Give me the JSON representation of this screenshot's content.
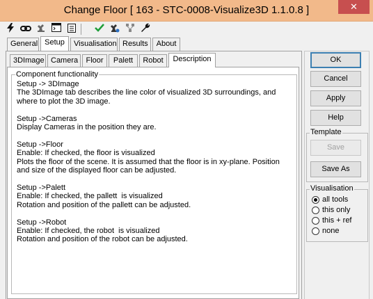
{
  "window": {
    "title": "Change Floor [ 163 - STC-0008-Visualize3D 1.1.0.8 ]",
    "close_glyph": "✕"
  },
  "toolbar": {
    "icons": [
      "lightning-icon",
      "chain-link-icon",
      "robot-icon",
      "console-icon",
      "clipboard-icon",
      "checkmark-icon",
      "robot-gear-icon",
      "network-icon",
      "wrench-icon"
    ]
  },
  "main_tabs": [
    "General",
    "Setup",
    "Visualisation",
    "Results",
    "About"
  ],
  "sub_tabs": [
    "3DImage",
    "Camera",
    "Floor",
    "Palett",
    "Robot",
    "Description"
  ],
  "component": {
    "legend": "Component functionality",
    "text": "Setup -> 3DImage\nThe 3DImage tab describes the line color of visualized 3D surroundings, and\nwhere to plot the 3D image.\n\nSetup ->Cameras\nDisplay Cameras in the position they are.\n\nSetup ->Floor\nEnable: If checked, the floor is visualized\nPlots the floor of the scene. It is assumed that the floor is in xy-plane. Position\nand size of the displayed floor can be adjusted.\n\nSetup ->Palett\nEnable: If checked, the pallett  is visualized\nRotation and position of the pallett can be adjusted.\n\nSetup ->Robot\nEnable: If checked, the robot  is visualized\nRotation and position of the robot can be adjusted."
  },
  "buttons": {
    "ok": "OK",
    "cancel": "Cancel",
    "apply": "Apply",
    "help": "Help"
  },
  "template": {
    "legend": "Template",
    "save": "Save",
    "save_as": "Save As"
  },
  "visualisation": {
    "legend": "Visualisation",
    "options": [
      "all tools",
      "this only",
      "this + ref",
      "none"
    ],
    "selected": "all tools"
  },
  "colors": {
    "titlebar": "#f2b98a",
    "close": "#c74f4f",
    "default_border": "#3c7fb1"
  }
}
